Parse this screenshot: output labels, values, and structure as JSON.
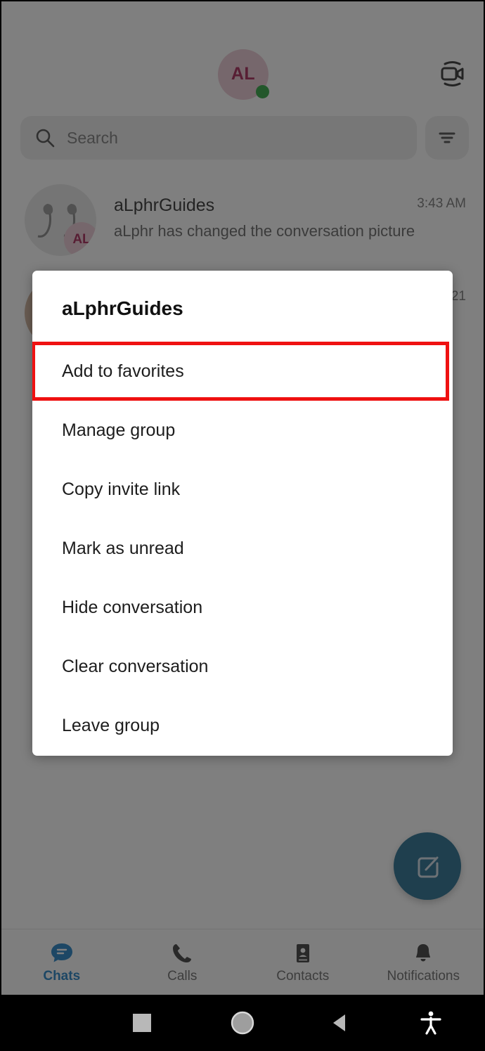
{
  "app": {
    "header": {
      "self_avatar_initials": "AL",
      "status": "online",
      "video_call_icon": "video-camera-icon"
    },
    "search": {
      "placeholder": "Search",
      "icon": "search-icon",
      "filter_icon": "filter-icon"
    },
    "chats": [
      {
        "title": "aLphrGuides",
        "subtitle": "aLphr has changed the conversation picture",
        "time": "3:43 AM",
        "badge_initials": "AL"
      },
      {
        "title": "",
        "subtitle": "",
        "time": "21",
        "badge_initials": ""
      }
    ],
    "fab": {
      "icon": "compose-icon",
      "color": "#0f5f85"
    },
    "tabs": [
      {
        "label": "Chats",
        "icon": "chat-bubble-icon",
        "active": true
      },
      {
        "label": "Calls",
        "icon": "phone-icon",
        "active": false
      },
      {
        "label": "Contacts",
        "icon": "contacts-book-icon",
        "active": false
      },
      {
        "label": "Notifications",
        "icon": "bell-icon",
        "active": false
      }
    ],
    "active_tab_color": "#0b74bd"
  },
  "dialog": {
    "title": "aLphrGuides",
    "highlight_color": "#ef1111",
    "items": [
      {
        "label": "Add to favorites",
        "highlighted": true
      },
      {
        "label": "Manage group",
        "highlighted": false
      },
      {
        "label": "Copy invite link",
        "highlighted": false
      },
      {
        "label": "Mark as unread",
        "highlighted": false
      },
      {
        "label": "Hide conversation",
        "highlighted": false
      },
      {
        "label": "Clear conversation",
        "highlighted": false
      },
      {
        "label": "Leave group",
        "highlighted": false
      }
    ]
  },
  "system_nav": {
    "recents": "square-recents-icon",
    "home": "circle-home-icon",
    "back": "triangle-back-icon",
    "accessibility": "accessibility-icon"
  }
}
